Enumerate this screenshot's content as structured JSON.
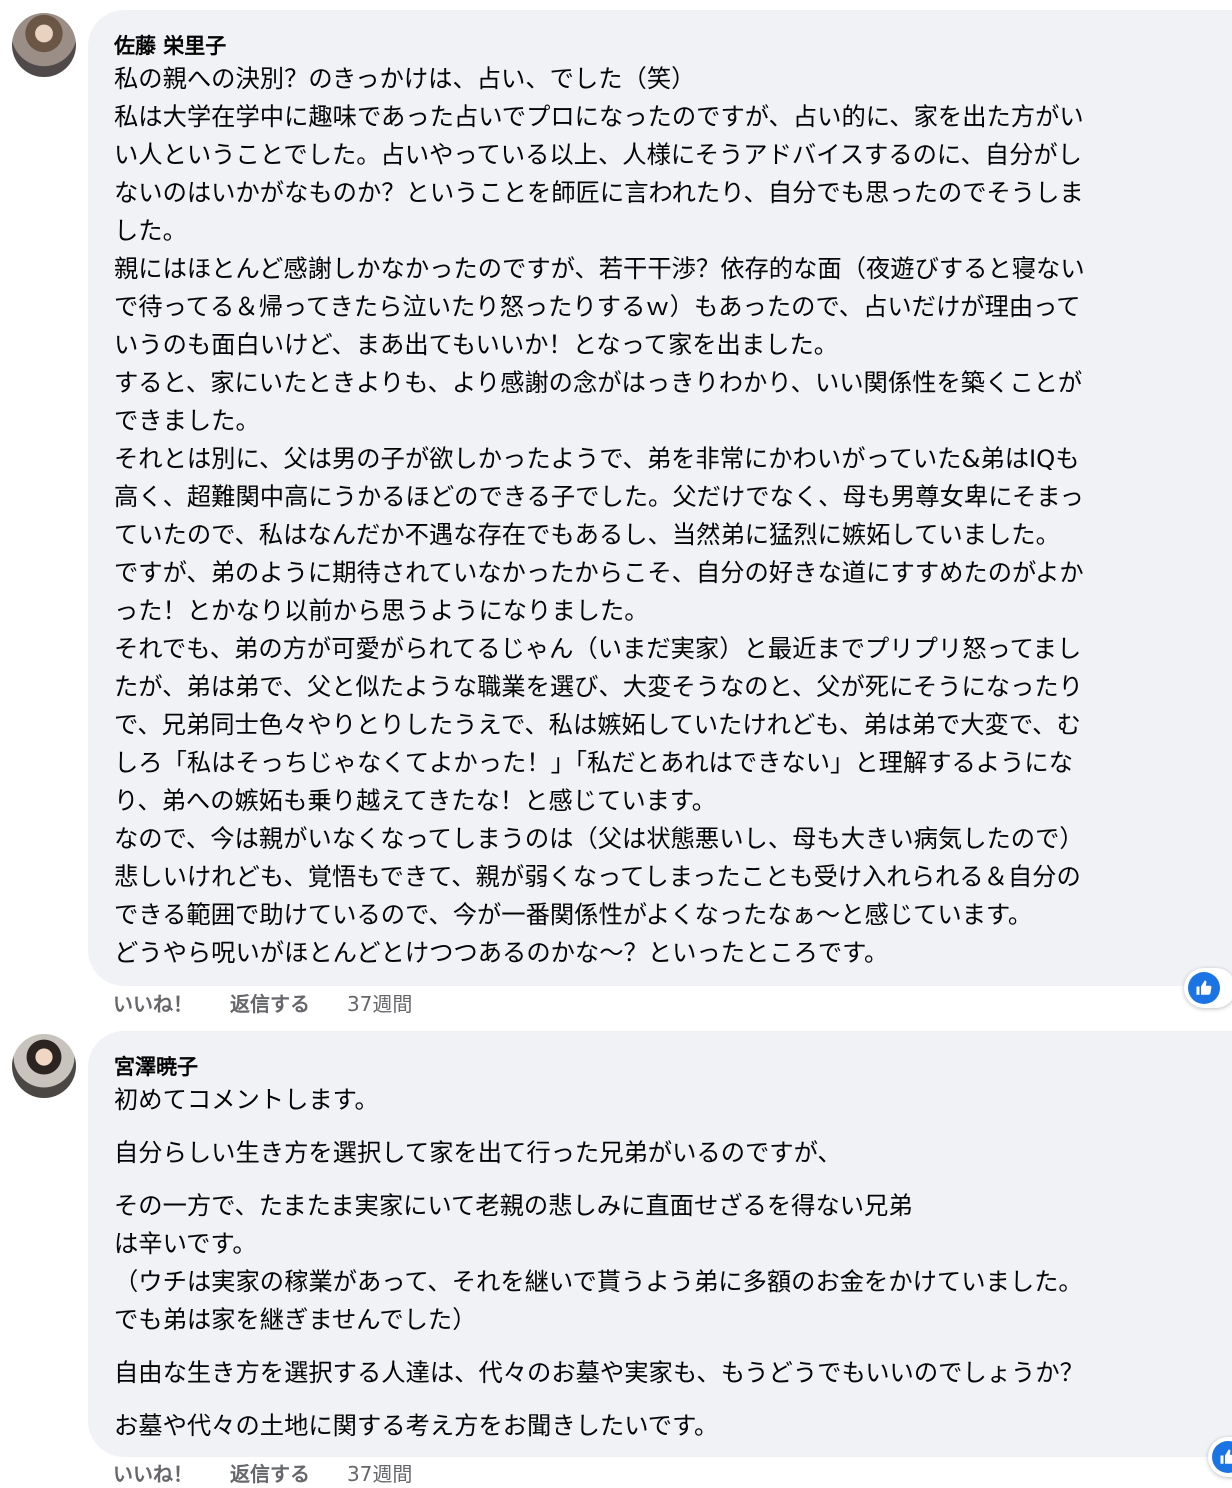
{
  "comments": [
    {
      "author": "佐藤 栄里子",
      "lines": [
        "私の親への決別？のきっかけは、占い、でした（笑）",
        "私は大学在学中に趣味であった占いでプロになったのですが、占い的に、家を出た方がい",
        "い人ということでした。占いやっている以上、人様にそうアドバイスするのに、自分がし",
        "ないのはいかがなものか？ということを師匠に言われたり、自分でも思ったのでそうしま",
        "した。",
        "親にはほとんど感謝しかなかったのですが、若干干渉？依存的な面（夜遊びすると寝ない",
        "で待ってる＆帰ってきたら泣いたり怒ったりするｗ）もあったので、占いだけが理由って",
        "いうのも面白いけど、まあ出てもいいか！となって家を出ました。",
        "すると、家にいたときよりも、より感謝の念がはっきりわかり、いい関係性を築くことが",
        "できました。",
        "それとは別に、父は男の子が欲しかったようで、弟を非常にかわいがっていた&弟はIQも",
        "高く、超難関中高にうかるほどのできる子でした。父だけでなく、母も男尊女卑にそまっ",
        "ていたので、私はなんだか不遇な存在でもあるし、当然弟に猛烈に嫉妬していました。",
        "ですが、弟のように期待されていなかったからこそ、自分の好きな道にすすめたのがよか",
        "った！とかなり以前から思うようになりました。",
        "それでも、弟の方が可愛がられてるじゃん（いまだ実家）と最近までプリプリ怒ってまし",
        "たが、弟は弟で、父と似たような職業を選び、大変そうなのと、父が死にそうになったり",
        "で、兄弟同士色々やりとりしたうえで、私は嫉妬していたけれども、弟は弟で大変で、む",
        "しろ「私はそっちじゃなくてよかった！」「私だとあれはできない」と理解するようにな",
        "り、弟への嫉妬も乗り越えてきたな！と感じています。",
        "なので、今は親がいなくなってしまうのは（父は状態悪いし、母も大きい病気したので）",
        "悲しいけれども、覚悟もできて、親が弱くなってしまったことも受け入れられる＆自分の",
        "できる範囲で助けているので、今が一番関係性がよくなったなぁ〜と感じています。",
        "どうやら呪いがほとんどとけつつあるのかな〜？といったところです。"
      ],
      "like_label": "いいね！",
      "reply_label": "返信する",
      "timestamp": "37週間"
    },
    {
      "author": "宮澤暁子",
      "lines": [
        "初めてコメントします。",
        "",
        "自分らしい生き方を選択して家を出て行った兄弟がいるのですが、",
        "",
        "その一方で、たまたま実家にいて老親の悲しみに直面せざるを得ない兄弟",
        "は辛いです。",
        "（ウチは実家の稼業があって、それを継いで貰うよう弟に多額のお金をかけていました。",
        "でも弟は家を継ぎませんでした）",
        "",
        "自由な生き方を選択する人達は、代々のお墓や実家も、もうどうでもいいのでしょうか？",
        "",
        "お墓や代々の土地に関する考え方をお聞きしたいです。"
      ],
      "like_label": "いいね！",
      "reply_label": "返信する",
      "timestamp": "37週間"
    }
  ],
  "reaction_icon": "thumbs-up-icon",
  "colors": {
    "bubble": "#f0f2f5",
    "meta_text": "#65676b",
    "like_blue": "#1b74e4"
  }
}
